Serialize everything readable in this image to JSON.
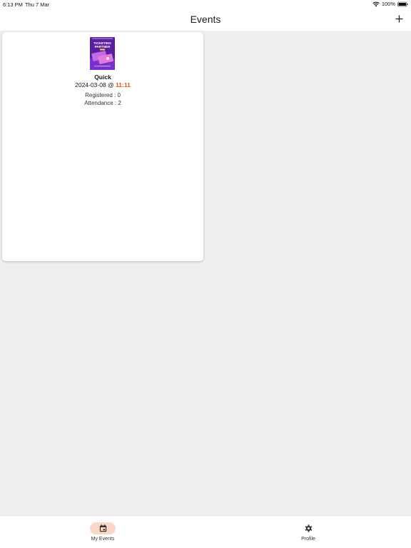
{
  "status_bar": {
    "time": "6:13 PM",
    "date": "Thu 7 Mar",
    "battery": "100%"
  },
  "header": {
    "title": "Events",
    "add_icon": "plus-icon"
  },
  "events": [
    {
      "poster_text": "TICKETING PARTNER",
      "name": "Quick",
      "date": "2024-03-08 @ ",
      "time": "11:11",
      "registered": "Registered : 0",
      "attendance": "Attendance : 2"
    }
  ],
  "bottom_nav": {
    "items": [
      {
        "label": "My Events",
        "icon": "calendar-icon",
        "active": true
      },
      {
        "label": "Profile",
        "icon": "gear-icon",
        "active": false
      }
    ]
  },
  "colors": {
    "accent": "#e0561d",
    "active_pill": "#fcd7c7",
    "background": "#efefef"
  }
}
